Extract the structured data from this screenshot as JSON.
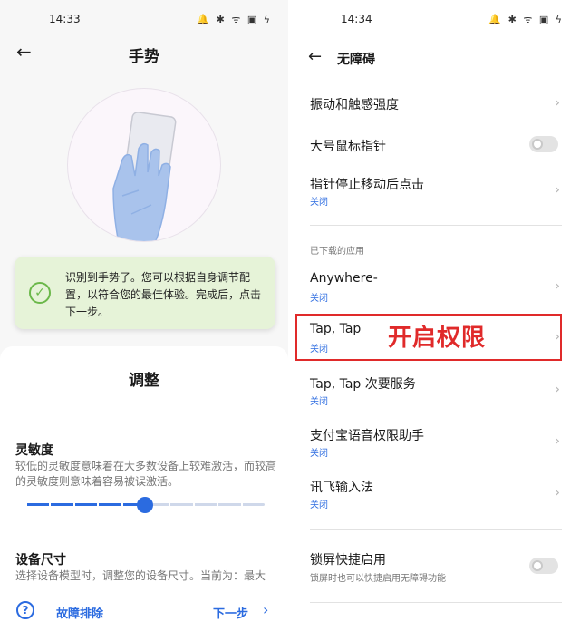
{
  "left": {
    "status_time": "14:33",
    "status_icons": "🔔 ✱ ᯤ ▣ ϟ",
    "title": "手势",
    "toast": {
      "text": "识别到手势了。您可以根据自身调节配置，以符合您的最佳体验。完成后，点击下一步。"
    },
    "card_title": "调整",
    "sensitivity": {
      "label": "灵敏度",
      "desc": "较低的灵敏度意味着在大多数设备上较难激活，而较高的灵敏度则意味着容易被误激活。",
      "level_fraction": 0.5,
      "steps": 11
    },
    "device_size": {
      "label": "设备尺寸",
      "desc": "选择设备模型时，调整您的设备尺寸。当前为：最大"
    },
    "bottom": {
      "help_icon": "?",
      "trouble_label": "故障排除",
      "next_label": "下一步",
      "next_chevron": "›"
    },
    "accent": "#2b6be0"
  },
  "right": {
    "status_time": "14:34",
    "status_icons": "🔔 ✱ ᯤ ▣ ϟ",
    "title": "无障碍",
    "items": [
      {
        "title": "振动和触感强度"
      },
      {
        "title": "大号鼠标指针"
      },
      {
        "title": "指针停止移动后点击",
        "sub": "关闭"
      }
    ],
    "section_label": "已下载的应用",
    "apps": [
      {
        "title": "Anywhere-",
        "sub": "关闭"
      },
      {
        "title": "Tap, Tap",
        "sub": "关闭"
      },
      {
        "title": "Tap, Tap 次要服务",
        "sub": "关闭"
      },
      {
        "title": "支付宝语音权限助手",
        "sub": "关闭"
      },
      {
        "title": "讯飞输入法",
        "sub": "关闭"
      }
    ],
    "lock": {
      "title": "锁屏快捷启用",
      "desc": "锁屏时也可以快捷启用无障碍功能"
    },
    "annotation": "开启权限",
    "annotation_color": "#e02a2a"
  }
}
